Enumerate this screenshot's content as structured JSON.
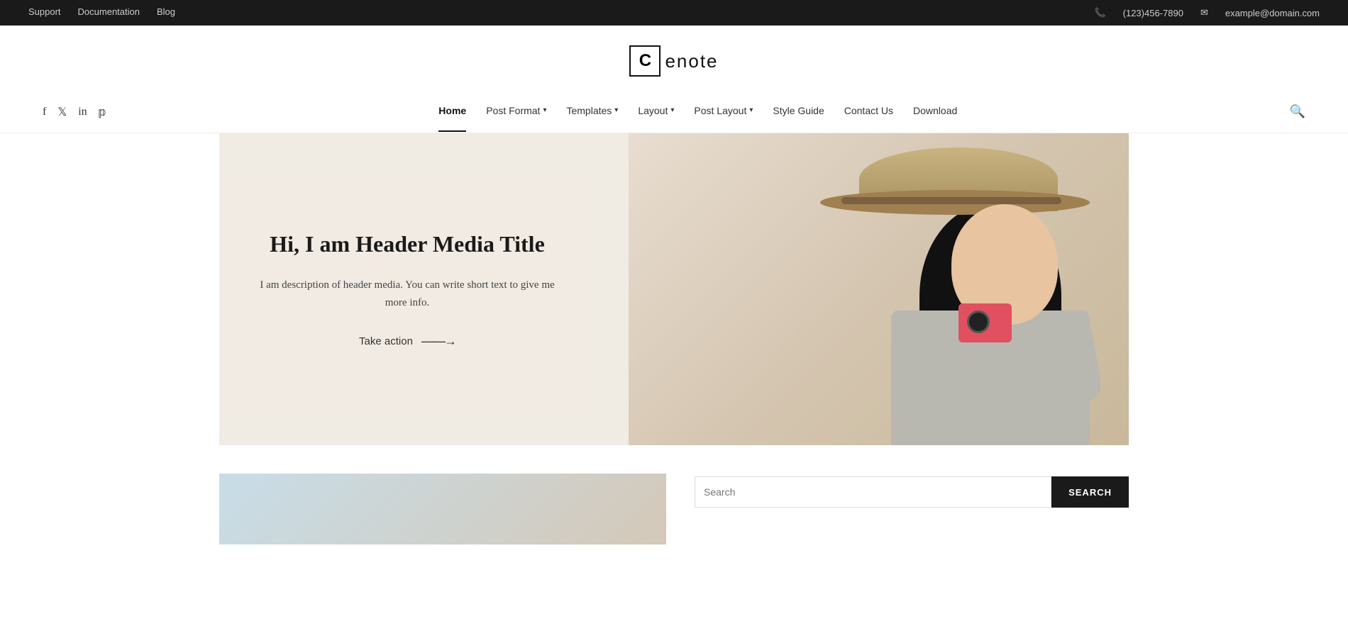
{
  "topbar": {
    "links": [
      {
        "label": "Support",
        "id": "support"
      },
      {
        "label": "Documentation",
        "id": "documentation"
      },
      {
        "label": "Blog",
        "id": "blog"
      }
    ],
    "phone": "(123)456-7890",
    "email": "example@domain.com"
  },
  "logo": {
    "letter": "C",
    "name": "enote"
  },
  "nav": {
    "items": [
      {
        "label": "Home",
        "id": "home",
        "active": true,
        "has_dropdown": false
      },
      {
        "label": "Post Format",
        "id": "post-format",
        "active": false,
        "has_dropdown": true
      },
      {
        "label": "Templates",
        "id": "templates",
        "active": false,
        "has_dropdown": true
      },
      {
        "label": "Layout",
        "id": "layout",
        "active": false,
        "has_dropdown": true
      },
      {
        "label": "Post Layout",
        "id": "post-layout",
        "active": false,
        "has_dropdown": true
      },
      {
        "label": "Style Guide",
        "id": "style-guide",
        "active": false,
        "has_dropdown": false
      },
      {
        "label": "Contact Us",
        "id": "contact-us",
        "active": false,
        "has_dropdown": false
      },
      {
        "label": "Download",
        "id": "download",
        "active": false,
        "has_dropdown": false
      }
    ],
    "social": [
      {
        "icon": "f",
        "id": "facebook",
        "unicode": "👤"
      },
      {
        "icon": "t",
        "id": "twitter"
      },
      {
        "icon": "in",
        "id": "linkedin"
      },
      {
        "icon": "p",
        "id": "pinterest"
      }
    ]
  },
  "hero": {
    "title": "Hi, I am Header Media Title",
    "description": "I am description of header media. You can write short text to give me more info.",
    "cta_label": "Take action",
    "cta_arrow": "——→"
  },
  "search": {
    "placeholder": "Search",
    "button_label": "SEARCH"
  }
}
